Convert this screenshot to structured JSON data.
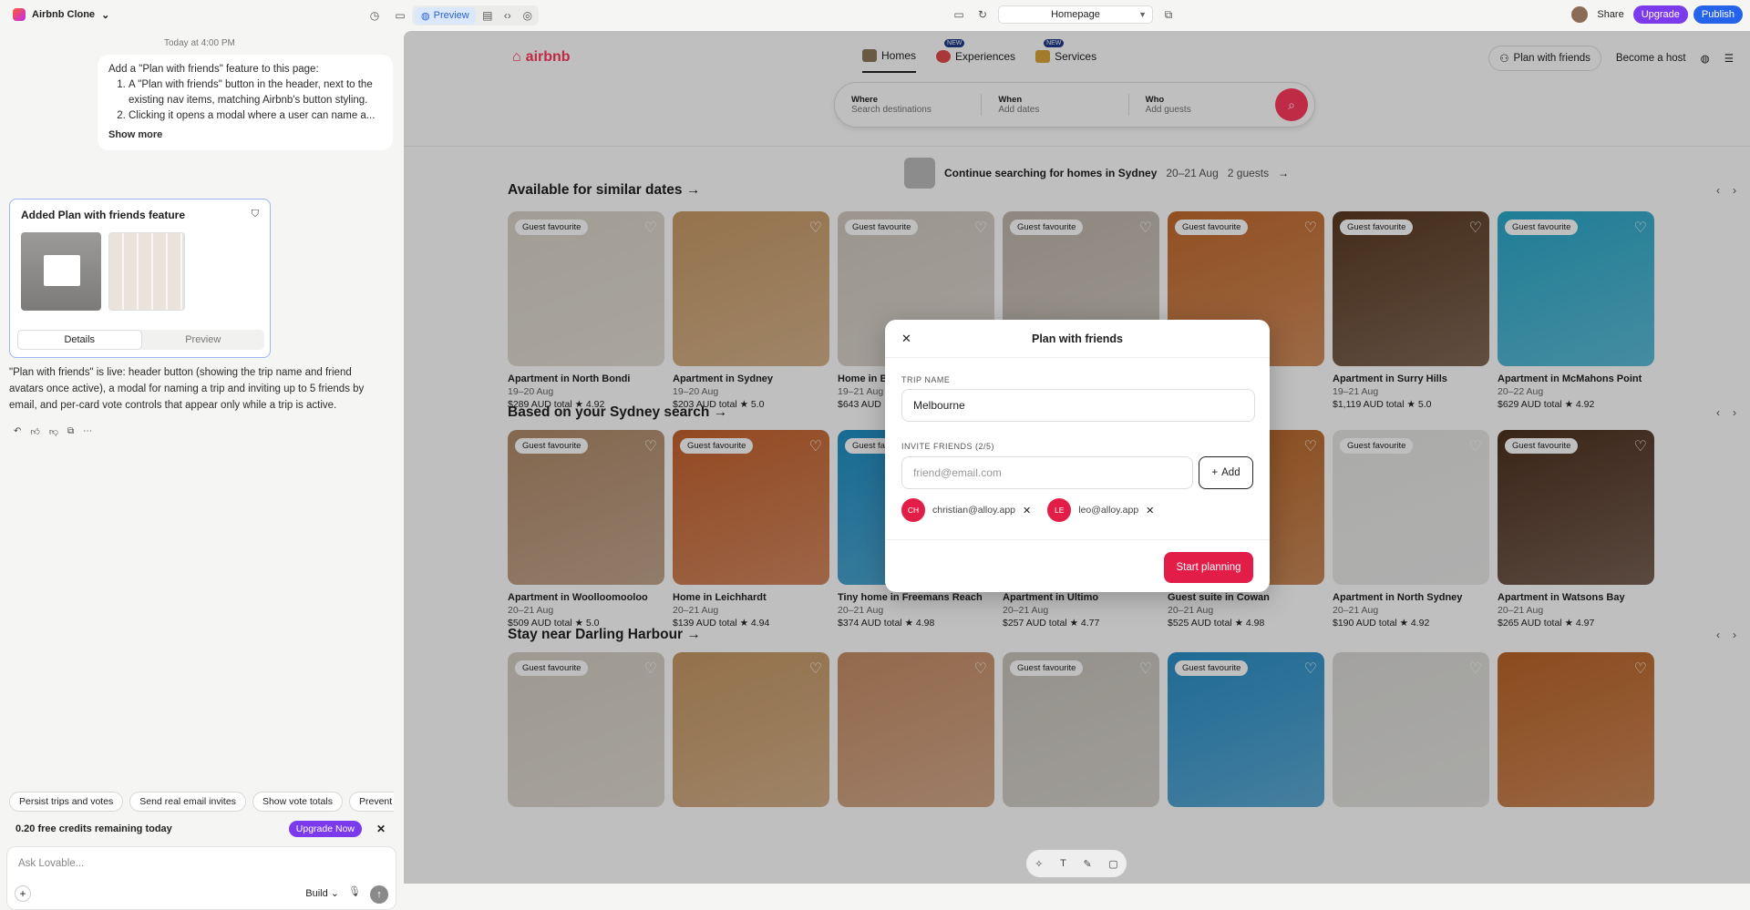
{
  "app": {
    "project": "Airbnb Clone",
    "preview_tab": "Preview",
    "route": "Homepage",
    "share": "Share",
    "upgrade": "Upgrade",
    "publish": "Publish"
  },
  "chat": {
    "timestamp": "Today at 4:00 PM",
    "prompt_intro": "Add a \"Plan with friends\" feature to this page:",
    "prompt_items": [
      "A \"Plan with friends\" button in the header, next to the existing nav items, matching Airbnb's button styling.",
      "Clicking it opens a modal where a user can name a..."
    ],
    "show_more": "Show more",
    "card_title": "Added Plan with friends feature",
    "card_tab_details": "Details",
    "card_tab_preview": "Preview",
    "summary": "\"Plan with friends\" is live: header button (showing the trip name and friend avatars once active), a modal for naming a trip and inviting up to 5 friends by email, and per-card vote controls that appear only while a trip is active.",
    "suggestions": [
      "Persist trips and votes",
      "Send real email invites",
      "Show vote totals",
      "Prevent duplic"
    ],
    "credits": "0.20 free credits remaining today",
    "upgrade_now": "Upgrade Now",
    "composer_placeholder": "Ask Lovable...",
    "build": "Build"
  },
  "site": {
    "brand": "airbnb",
    "nav": [
      {
        "label": "Homes",
        "new": ""
      },
      {
        "label": "Experiences",
        "new": "NEW"
      },
      {
        "label": "Services",
        "new": "NEW"
      }
    ],
    "plan_with_friends": "Plan with friends",
    "become_host": "Become a host",
    "search": [
      {
        "label": "Where",
        "ph": "Search destinations"
      },
      {
        "label": "When",
        "ph": "Add dates"
      },
      {
        "label": "Who",
        "ph": "Add guests"
      }
    ],
    "continue": {
      "text": "Continue searching for homes in Sydney",
      "dates": "20–21 Aug",
      "guests": "2 guests"
    },
    "sections": [
      {
        "title": "Available for similar dates",
        "listings": [
          {
            "title": "Apartment in North Bondi",
            "dates": "19–20 Aug",
            "price": "$289 AUD total",
            "rating": "★ 4.92",
            "badge": true,
            "color": "#d8d2c6"
          },
          {
            "title": "Apartment in Sydney",
            "dates": "19–20 Aug",
            "price": "$203 AUD total",
            "rating": "★ 5.0",
            "badge": false,
            "color": "#c79a66"
          },
          {
            "title": "Home in Bu",
            "dates": "19–21 Aug",
            "price": "$643 AUD",
            "rating": "",
            "badge": true,
            "color": "#cfc8be"
          },
          {
            "title": "",
            "dates": "",
            "price": "",
            "rating": "",
            "badge": true,
            "color": "#bdb5aa"
          },
          {
            "title": "ls",
            "dates": "",
            "price": "",
            "rating": "",
            "badge": true,
            "color": "#c26a2c"
          },
          {
            "title": "Apartment in Surry Hills",
            "dates": "19–21 Aug",
            "price": "$1,119 AUD total",
            "rating": "★ 5.0",
            "badge": true,
            "color": "#5a3a22"
          },
          {
            "title": "Apartment in McMahons Point",
            "dates": "20–22 Aug",
            "price": "$629 AUD total",
            "rating": "★ 4.92",
            "badge": true,
            "color": "#2aa7c9"
          }
        ]
      },
      {
        "title": "Based on your Sydney search",
        "listings": [
          {
            "title": "Apartment in Woolloomooloo",
            "dates": "20–21 Aug",
            "price": "$509 AUD total",
            "rating": "★ 5.0",
            "badge": true,
            "color": "#b08a6a"
          },
          {
            "title": "Home in Leichhardt",
            "dates": "20–21 Aug",
            "price": "$139 AUD total",
            "rating": "★ 4.94",
            "badge": true,
            "color": "#c4622e"
          },
          {
            "title": "Tiny home in Freemans Reach",
            "dates": "20–21 Aug",
            "price": "$374 AUD total",
            "rating": "★ 4.98",
            "badge": true,
            "color": "#1f8ec4"
          },
          {
            "title": "Apartment in Ultimo",
            "dates": "20–21 Aug",
            "price": "$257 AUD total",
            "rating": "★ 4.77",
            "badge": false,
            "color": "#d6d1c8"
          },
          {
            "title": "Guest suite in Cowan",
            "dates": "20–21 Aug",
            "price": "$525 AUD total",
            "rating": "★ 4.98",
            "badge": false,
            "color": "#b86526"
          },
          {
            "title": "Apartment in North Sydney",
            "dates": "20–21 Aug",
            "price": "$190 AUD total",
            "rating": "★ 4.92",
            "badge": true,
            "color": "#e4e4e2"
          },
          {
            "title": "Apartment in Watsons Bay",
            "dates": "20–21 Aug",
            "price": "$265 AUD total",
            "rating": "★ 4.97",
            "badge": true,
            "color": "#4e3120"
          }
        ]
      },
      {
        "title": "Stay near Darling Harbour",
        "listings": [
          {
            "title": "",
            "dates": "",
            "price": "",
            "rating": "",
            "badge": true,
            "color": "#d3cdc2"
          },
          {
            "title": "",
            "dates": "",
            "price": "",
            "rating": "",
            "badge": false,
            "color": "#c59764"
          },
          {
            "title": "",
            "dates": "",
            "price": "",
            "rating": "",
            "badge": false,
            "color": "#c58d66"
          },
          {
            "title": "",
            "dates": "",
            "price": "",
            "rating": "",
            "badge": true,
            "color": "#c7c3bb"
          },
          {
            "title": "",
            "dates": "",
            "price": "",
            "rating": "",
            "badge": true,
            "color": "#2a8fc7"
          },
          {
            "title": "",
            "dates": "",
            "price": "",
            "rating": "",
            "badge": false,
            "color": "#dad9d6"
          },
          {
            "title": "",
            "dates": "",
            "price": "",
            "rating": "",
            "badge": false,
            "color": "#bb6427"
          }
        ]
      }
    ],
    "badge_text": "Guest favourite"
  },
  "modal": {
    "title": "Plan with friends",
    "trip_label": "TRIP NAME",
    "trip_value": "Melbourne",
    "invite_label": "INVITE FRIENDS (2/5)",
    "email_placeholder": "friend@email.com",
    "add": "Add",
    "friends": [
      {
        "initials": "CH",
        "email": "christian@alloy.app"
      },
      {
        "initials": "LE",
        "email": "leo@alloy.app"
      }
    ],
    "start": "Start planning"
  }
}
